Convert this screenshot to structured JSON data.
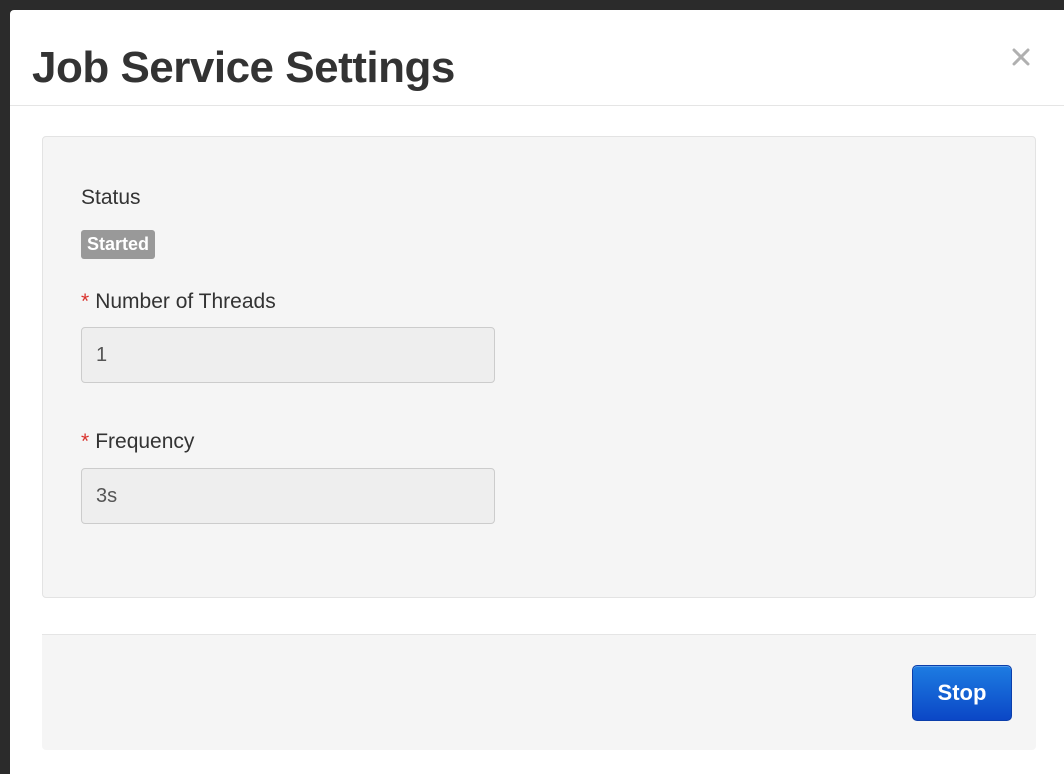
{
  "modal": {
    "title": "Job Service Settings",
    "close_label": "×"
  },
  "status": {
    "label": "Status",
    "badge": "Started"
  },
  "threads": {
    "required_marker": "*",
    "label": "Number of Threads",
    "value": "1"
  },
  "frequency": {
    "required_marker": "*",
    "label": "Frequency",
    "value": "3s"
  },
  "footer": {
    "stop_label": "Stop"
  },
  "colors": {
    "required": "#d9312b",
    "badge_bg": "#999999",
    "button_primary": "#0b47c6"
  }
}
